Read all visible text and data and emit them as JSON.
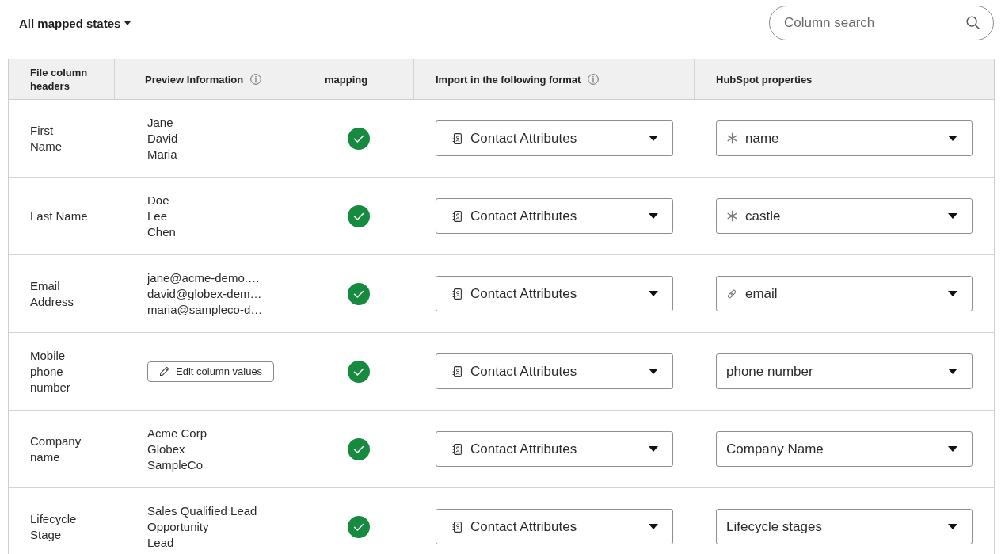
{
  "filter": {
    "label": "All mapped states"
  },
  "search": {
    "placeholder": "Column search"
  },
  "table": {
    "columns": [
      {
        "label": "File column headers",
        "info": false
      },
      {
        "label": "Preview Information",
        "info": true
      },
      {
        "label": "mapping",
        "info": false
      },
      {
        "label": "Import in the following format",
        "info": true
      },
      {
        "label": "HubSpot properties",
        "info": false
      }
    ],
    "rows": [
      {
        "file_column": "First\nName",
        "preview": {
          "kind": "values",
          "values": [
            "Jane",
            "David",
            "Maria"
          ]
        },
        "mapped": true,
        "import_format": "Contact Attributes",
        "property": {
          "kind": "asterisk",
          "label": "name"
        }
      },
      {
        "file_column": "Last Name",
        "preview": {
          "kind": "values",
          "values": [
            "Doe",
            "Lee",
            "Chen"
          ]
        },
        "mapped": true,
        "import_format": "Contact Attributes",
        "property": {
          "kind": "asterisk",
          "label": "castle"
        }
      },
      {
        "file_column": "Email\nAddress",
        "preview": {
          "kind": "values",
          "values": [
            "jane@acme-demo.…",
            "david@globex-dem…",
            "maria@sampleco-d…"
          ]
        },
        "mapped": true,
        "import_format": "Contact Attributes",
        "property": {
          "kind": "link",
          "label": "email"
        }
      },
      {
        "file_column": "Mobile\nphone\nnumber",
        "preview": {
          "kind": "edit_button",
          "label": "Edit column values"
        },
        "mapped": true,
        "import_format": "Contact Attributes",
        "property": {
          "kind": "plain",
          "label": "phone number"
        }
      },
      {
        "file_column": "Company\nname",
        "preview": {
          "kind": "values",
          "values": [
            "Acme Corp",
            "Globex",
            "SampleCo"
          ]
        },
        "mapped": true,
        "import_format": "Contact Attributes",
        "property": {
          "kind": "plain",
          "label": "Company Name"
        }
      },
      {
        "file_column": "Lifecycle\nStage",
        "preview": {
          "kind": "values",
          "values": [
            "Sales Qualified Lead",
            "Opportunity",
            "Lead"
          ]
        },
        "mapped": true,
        "import_format": "Contact Attributes",
        "property": {
          "kind": "plain",
          "label": "Lifecycle stages"
        }
      }
    ]
  }
}
